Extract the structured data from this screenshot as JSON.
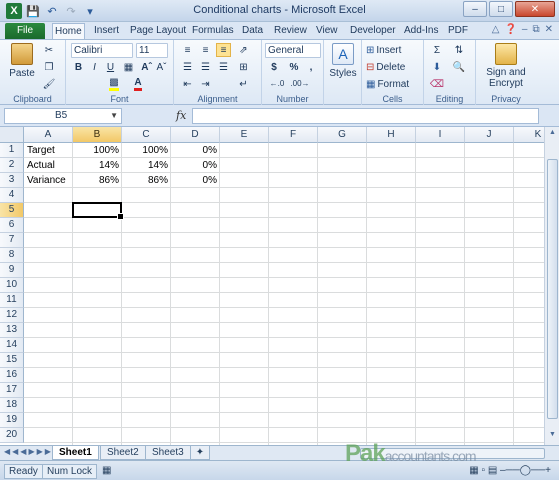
{
  "window": {
    "title": "Conditional charts - Microsoft Excel"
  },
  "tabs": [
    "File",
    "Home",
    "Insert",
    "Page Layout",
    "Formulas",
    "Data",
    "Review",
    "View",
    "Developer",
    "Add-Ins",
    "PDF"
  ],
  "ribbon": {
    "font_name": "Calibri",
    "font_size": "11",
    "number_format": "General",
    "paste": "Paste",
    "styles": "Styles",
    "insert": "Insert",
    "delete": "Delete",
    "format": "Format",
    "sign_encrypt": [
      "Sign and",
      "Encrypt"
    ],
    "bold": "B",
    "italic": "I",
    "underline": "U",
    "currency": "$",
    "percent": "%",
    "comma": ",",
    "groups": [
      "Clipboard",
      "Font",
      "Alignment",
      "Number",
      "Cells",
      "Editing",
      "Privacy"
    ]
  },
  "formula_bar": {
    "name_box": "B5",
    "fx": "fx",
    "formula": ""
  },
  "columns": [
    "A",
    "B",
    "C",
    "D",
    "E",
    "F",
    "G",
    "H",
    "I",
    "J",
    "K"
  ],
  "rows": [
    "1",
    "2",
    "3",
    "4",
    "5",
    "6",
    "7",
    "8",
    "9",
    "10",
    "11",
    "12",
    "13",
    "14",
    "15",
    "16",
    "17",
    "18",
    "19",
    "20"
  ],
  "cells": [
    {
      "a": "Target",
      "b": "100%",
      "c": "100%",
      "d": "0%"
    },
    {
      "a": "Actual",
      "b": "14%",
      "c": "14%",
      "d": "0%"
    },
    {
      "a": "Variance",
      "b": "86%",
      "c": "86%",
      "d": "0%"
    }
  ],
  "sheets": [
    "Sheet1",
    "Sheet2",
    "Sheet3"
  ],
  "status": {
    "ready": "Ready",
    "num_lock": "Num Lock"
  },
  "watermark": {
    "main": "Pak",
    "sub": "accountants.com"
  },
  "colors": {
    "file_tab": "#1a6a2c",
    "selection_header": "#f2c867"
  }
}
